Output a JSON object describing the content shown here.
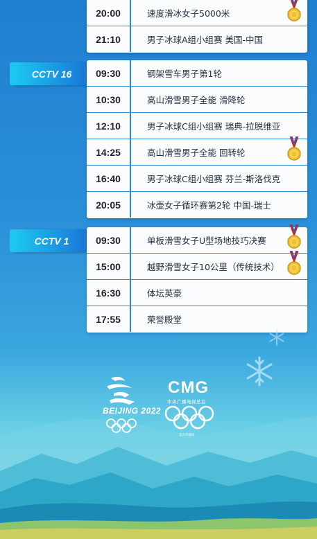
{
  "channels": [
    {
      "name": "",
      "rows": [
        {
          "time": "20:00",
          "event": "速度滑冰女子5000米",
          "medal": true
        },
        {
          "time": "21:10",
          "event": "男子冰球A组小组赛  美国-中国",
          "medal": false
        }
      ]
    },
    {
      "name": "CCTV 16",
      "rows": [
        {
          "time": "09:30",
          "event": "钢架雪车男子第1轮",
          "medal": false
        },
        {
          "time": "10:30",
          "event": "高山滑雪男子全能  滑降轮",
          "medal": false
        },
        {
          "time": "12:10",
          "event": "男子冰球C组小组赛  瑞典-拉脱维亚",
          "medal": false
        },
        {
          "time": "14:25",
          "event": "高山滑雪男子全能  回转轮",
          "medal": true
        },
        {
          "time": "16:40",
          "event": "男子冰球C组小组赛  芬兰-斯洛伐克",
          "medal": false
        },
        {
          "time": "20:05",
          "event": "冰壶女子循环赛第2轮  中国-瑞士",
          "medal": false
        }
      ]
    },
    {
      "name": "CCTV 1",
      "rows": [
        {
          "time": "09:30",
          "event": "单板滑雪女子U型场地技巧决赛",
          "medal": true
        },
        {
          "time": "15:00",
          "event": "越野滑雪女子10公里（传统技术）",
          "medal": true
        },
        {
          "time": "16:30",
          "event": "体坛英豪",
          "medal": false
        },
        {
          "time": "17:55",
          "event": "荣誉殿堂",
          "medal": false
        }
      ]
    }
  ],
  "logos": {
    "beijing": "BEIJING 2022",
    "cmg": "CMG",
    "cmg_sub": "中央广播电视总台",
    "cmg_small": "官方转播商"
  },
  "icons": [
    "gold-medal-icon",
    "snowflake-icon",
    "beijing-2022-emblem",
    "olympic-rings-icon"
  ],
  "colors": {
    "accent": "#1a74d6",
    "tag_start": "#1cc6f0",
    "divider": "#2a8bd3",
    "gold": "#f2c230"
  }
}
